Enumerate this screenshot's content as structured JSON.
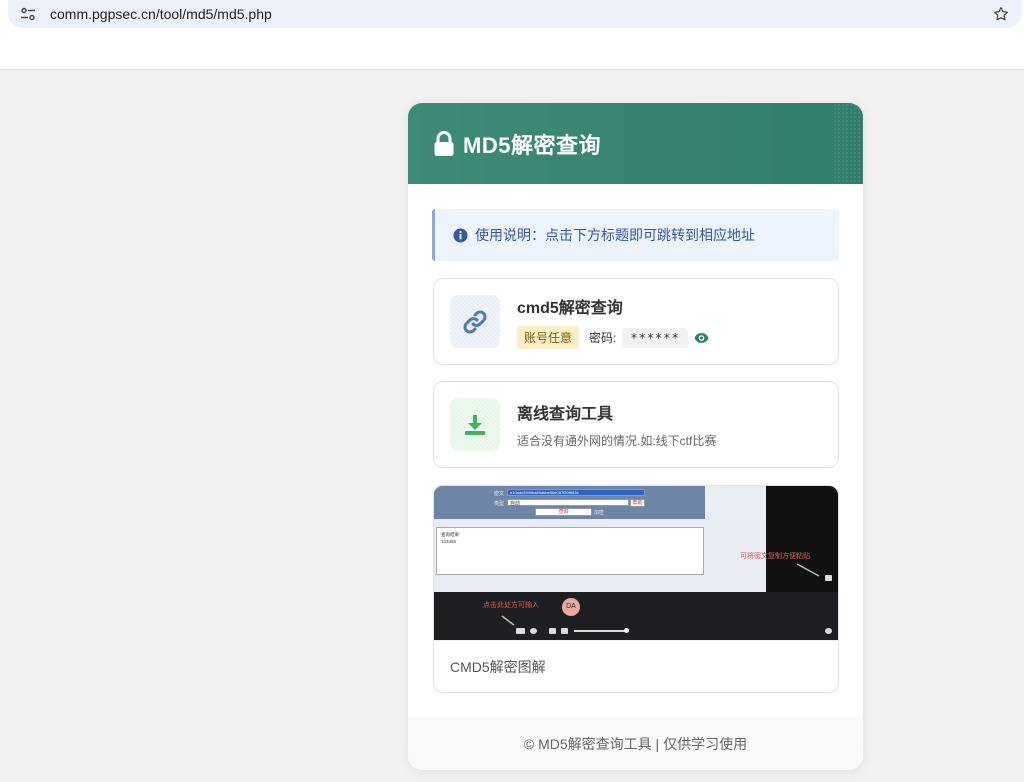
{
  "browser": {
    "url": "comm.pgpsec.cn/tool/md5/md5.php"
  },
  "header": {
    "title": "MD5解密查询",
    "icon": "lock-icon"
  },
  "info": {
    "text": "使用说明：点击下方标题即可跳转到相应地址",
    "icon": "info-icon"
  },
  "items": [
    {
      "title": "cmd5解密查询",
      "icon": "link-icon",
      "badge": "账号任意",
      "password_label": "密码:",
      "password_value": "******"
    },
    {
      "title": "离线查询工具",
      "icon": "download-icon",
      "description": "适合没有通外网的情况.如:线下ctf比赛"
    }
  ],
  "media": {
    "caption": "CMD5解密图解",
    "screenshot": {
      "label_1": "密文",
      "label_2": "类型",
      "input_value": "e10adc3949ba59abbe56e057f20f883e",
      "select_value": "自动",
      "query_button": "查询",
      "secondary_button": "加密",
      "side_button": "帮助",
      "result_title": "查询结果:",
      "result_value": "123456",
      "annotation_right": "可将密文复制方便粘贴",
      "annotation_left": "点击此处方可输入",
      "avatar": "DA"
    }
  },
  "footer": {
    "text": "© MD5解密查询工具 | 仅供学习使用"
  },
  "colors": {
    "header": "#3d8b78",
    "info_text": "#3256b8",
    "badge_bg": "#fdf0c7",
    "eye": "#2f7f6d"
  }
}
